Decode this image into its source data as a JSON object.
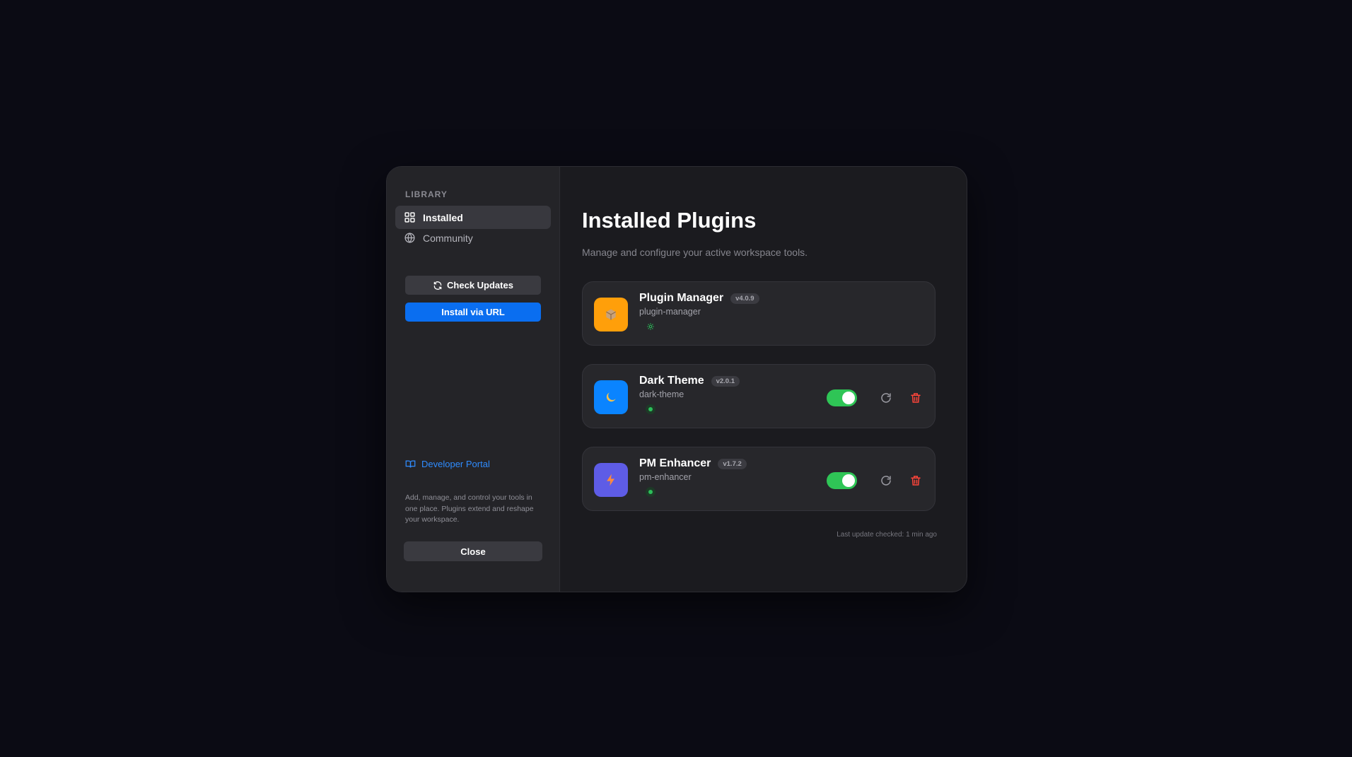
{
  "sidebar": {
    "section_label": "LIBRARY",
    "nav": [
      {
        "label": "Installed",
        "icon": "grid-icon",
        "active": true
      },
      {
        "label": "Community",
        "icon": "globe-icon",
        "active": false
      }
    ],
    "check_updates_label": "Check Updates",
    "install_url_label": "Install via URL",
    "developer_portal_label": "Developer Portal",
    "description": "Add, manage, and control your tools in one place. Plugins extend and reshape your workspace.",
    "close_label": "Close"
  },
  "main": {
    "title": "Installed Plugins",
    "subtitle": "Manage and configure your active workspace tools.",
    "plugins": [
      {
        "name": "Plugin Manager",
        "version": "v4.0.9",
        "slug": "plugin-manager",
        "icon": "package-icon",
        "icon_color": "#ff9f0a",
        "status": "gear",
        "has_controls": false
      },
      {
        "name": "Dark Theme",
        "version": "v2.0.1",
        "slug": "dark-theme",
        "icon": "moon-icon",
        "icon_color": "#0a84ff",
        "status": "active",
        "enabled": true,
        "has_controls": true
      },
      {
        "name": "PM Enhancer",
        "version": "v1.7.2",
        "slug": "pm-enhancer",
        "icon": "lightning-icon",
        "icon_color": "#5e5ce6",
        "status": "active",
        "enabled": true,
        "has_controls": true
      }
    ],
    "footer_note": "Last update checked: 1 min ago"
  },
  "colors": {
    "accent": "#0a6ef0",
    "toggle_on": "#2fc556",
    "danger": "#ff453a",
    "link": "#2f8cff"
  }
}
